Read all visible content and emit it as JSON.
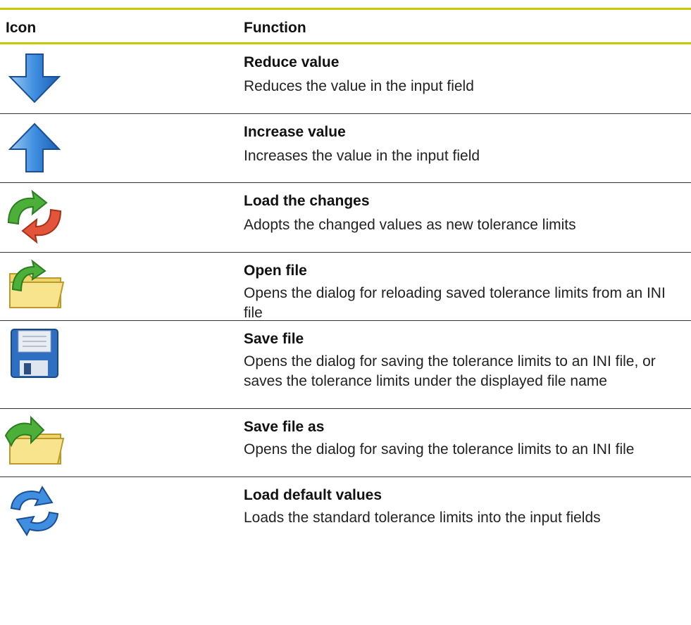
{
  "header": {
    "icon_col": "Icon",
    "function_col": "Function"
  },
  "rows": [
    {
      "icon": "arrow-down-icon",
      "title": "Reduce value",
      "desc": "Reduces the value in the input field"
    },
    {
      "icon": "arrow-up-icon",
      "title": "Increase value",
      "desc": "Increases the value in the input field"
    },
    {
      "icon": "load-changes-icon",
      "title": "Load the changes",
      "desc": "Adopts the changed values as new tolerance limits"
    },
    {
      "icon": "open-file-icon",
      "title": "Open file",
      "desc": "Opens the dialog for reloading saved tolerance limits from an INI file"
    },
    {
      "icon": "save-file-icon",
      "title": "Save file",
      "desc": "Opens the dialog for saving the tolerance limits to an INI file, or saves the tolerance limits under the displayed file name"
    },
    {
      "icon": "save-file-as-icon",
      "title": "Save file as",
      "desc": "Opens the dialog for saving the tolerance limits to an INI file"
    },
    {
      "icon": "load-default-values-icon",
      "title": "Load default values",
      "desc": "Loads the standard tolerance limits into the input fields"
    }
  ]
}
